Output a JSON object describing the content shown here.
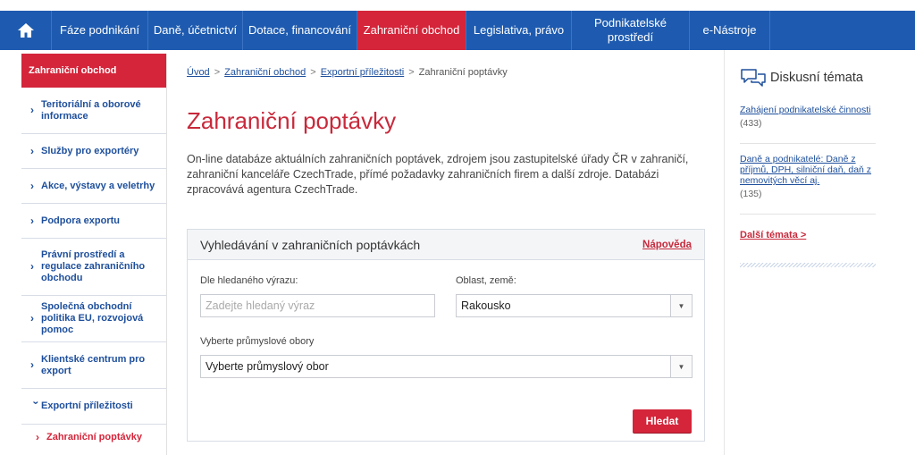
{
  "nav": {
    "items": [
      {
        "label": "Fáze podnikání"
      },
      {
        "label": "Daně, účetnictví"
      },
      {
        "label": "Dotace, financování"
      },
      {
        "label": "Zahraniční obchod"
      },
      {
        "label": "Legislativa, právo"
      },
      {
        "label": "Podnikatelské",
        "label2": "prostředí"
      },
      {
        "label": "e-Nástroje"
      }
    ],
    "active_index": 3
  },
  "sidebar": {
    "header": "Zahraniční obchod",
    "items": [
      {
        "label": "Teritoriální a oborové informace"
      },
      {
        "label": "Služby pro exportéry"
      },
      {
        "label": "Akce, výstavy a veletrhy"
      },
      {
        "label": "Podpora exportu"
      },
      {
        "label": "Právní prostředí a regulace zahraničního obchodu"
      },
      {
        "label": "Společná obchodní politika EU, rozvojová pomoc"
      },
      {
        "label": "Klientské centrum pro export"
      },
      {
        "label": "Exportní příležitosti"
      },
      {
        "label": "Zahraniční poptávky"
      }
    ]
  },
  "breadcrumb": {
    "items": [
      "Úvod",
      "Zahraniční obchod",
      "Exportní příležitosti",
      "Zahraniční poptávky"
    ]
  },
  "main": {
    "title": "Zahraniční poptávky",
    "intro": "On-line databáze aktuálních zahraničních poptávek, zdrojem jsou zastupitelské úřady ČR v zahraničí, zahraniční kanceláře CzechTrade, přímé požadavky zahraničních firem a další zdroje. Databázi zpracovává agentura CzechTrade."
  },
  "search": {
    "title": "Vyhledávání v zahraničních poptávkách",
    "help": "Nápověda",
    "keyword_label": "Dle hledaného výrazu:",
    "keyword_placeholder": "Zadejte hledaný výraz",
    "region_label": "Oblast, země:",
    "region_value": "Rakousko",
    "industry_label": "Vyberte průmyslové obory",
    "industry_value": "Vyberte průmyslový obor",
    "submit": "Hledat"
  },
  "discussion": {
    "title": "Diskusní témata",
    "topics": [
      {
        "title": "Zahájení podnikatelské činnosti",
        "count": "(433)"
      },
      {
        "title": "Daně a podnikatelé: Daně z příjmů, DPH, silniční daň, daň z nemovitých věcí aj.",
        "count": "(135)"
      }
    ],
    "more": "Další témata >"
  },
  "colors": {
    "nav": "#1e5bb0",
    "accent": "#d4253a",
    "link": "#1e4f9c"
  }
}
